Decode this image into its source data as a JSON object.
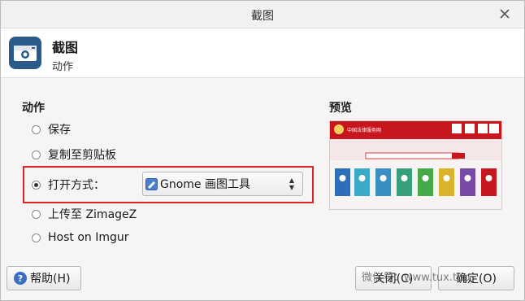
{
  "window": {
    "title": "截图"
  },
  "header": {
    "title": "截图",
    "subtitle": "动作"
  },
  "actions": {
    "section_label": "动作",
    "options": [
      {
        "label": "保存",
        "selected": false
      },
      {
        "label": "复制至剪贴板",
        "selected": false
      },
      {
        "label": "打开方式：",
        "selected": true
      },
      {
        "label": "上传至 ZimageZ",
        "selected": false
      },
      {
        "label": "Host on Imgur",
        "selected": false
      }
    ],
    "open_with_value": "Gnome 画图工具"
  },
  "preview": {
    "label": "预览",
    "site_title": "中国法律服务网"
  },
  "buttons": {
    "help": "帮助(H)",
    "close": "关闭(C)",
    "ok": "确定(O)"
  },
  "watermark": "微信号：www.tux.top",
  "colors": {
    "highlight": "#d9262a",
    "app_icon_bg": "#2c5a8a",
    "preview_header": "#c8161e"
  }
}
